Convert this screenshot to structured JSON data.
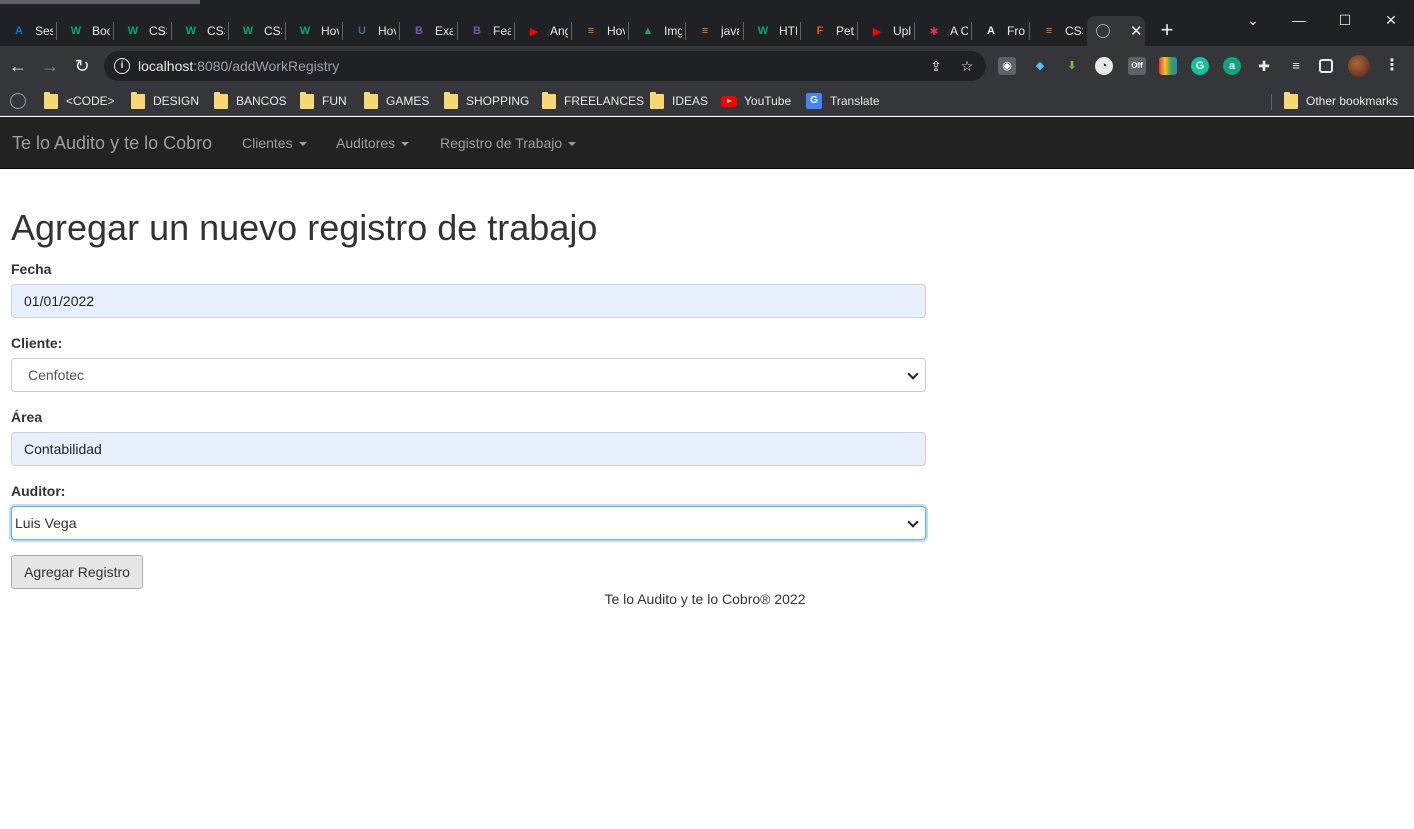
{
  "browser": {
    "tabs": [
      {
        "title": "Ses",
        "icon": "azure-icon",
        "color": "#0078d4",
        "glyph": "A"
      },
      {
        "title": "Boo",
        "icon": "w3schools-icon",
        "color": "#04aa6d",
        "glyph": "W"
      },
      {
        "title": "CSS",
        "icon": "w3schools-icon",
        "color": "#04aa6d",
        "glyph": "W"
      },
      {
        "title": "CSS",
        "icon": "w3schools-icon",
        "color": "#04aa6d",
        "glyph": "W"
      },
      {
        "title": "CSS",
        "icon": "w3schools-icon",
        "color": "#04aa6d",
        "glyph": "W"
      },
      {
        "title": "Hov",
        "icon": "w3schools-icon",
        "color": "#04aa6d",
        "glyph": "W"
      },
      {
        "title": "Hov",
        "icon": "site-icon",
        "color": "#3c6e8f",
        "glyph": "U"
      },
      {
        "title": "Exa",
        "icon": "bootstrap-icon",
        "color": "#7952b3",
        "glyph": "B"
      },
      {
        "title": "Fea",
        "icon": "bootstrap-icon",
        "color": "#7952b3",
        "glyph": "B"
      },
      {
        "title": "Ang",
        "icon": "youtube-icon",
        "color": "#ff0000",
        "glyph": "▶"
      },
      {
        "title": "Hov",
        "icon": "stackoverflow-icon",
        "color": "#f48024",
        "glyph": "≡"
      },
      {
        "title": "Img",
        "icon": "google-drive-icon",
        "color": "#1fa463",
        "glyph": "▲"
      },
      {
        "title": "java",
        "icon": "stackoverflow-icon",
        "color": "#f48024",
        "glyph": "≡"
      },
      {
        "title": "HTM",
        "icon": "w3schools-icon",
        "color": "#04aa6d",
        "glyph": "W"
      },
      {
        "title": "Pet",
        "icon": "figma-icon",
        "color": "#f24e1e",
        "glyph": "F"
      },
      {
        "title": "Upl",
        "icon": "youtube-icon",
        "color": "#ff0000",
        "glyph": "▶"
      },
      {
        "title": "A C",
        "icon": "asterisk-icon",
        "color": "#e0344b",
        "glyph": "✱"
      },
      {
        "title": "Fro",
        "icon": "angular-icon",
        "color": "#e8eaed",
        "glyph": "A"
      },
      {
        "title": "CSS",
        "icon": "stackoverflow-icon",
        "color": "#f48024",
        "glyph": "≡"
      }
    ],
    "url_host": "localhost",
    "url_path": ":8080/addWorkRegistry",
    "bookmarks": [
      {
        "label": "<CODE>",
        "type": "folder"
      },
      {
        "label": "DESIGN",
        "type": "folder"
      },
      {
        "label": "BANCOS",
        "type": "folder"
      },
      {
        "label": "FUN",
        "type": "folder"
      },
      {
        "label": "GAMES",
        "type": "folder"
      },
      {
        "label": "SHOPPING",
        "type": "folder"
      },
      {
        "label": "FREELANCES",
        "type": "folder"
      },
      {
        "label": "IDEAS",
        "type": "folder"
      },
      {
        "label": "YouTube",
        "type": "youtube"
      },
      {
        "label": "Translate",
        "type": "translate"
      }
    ],
    "other_bookmarks": "Other bookmarks"
  },
  "app": {
    "brand": "Te lo Audito y te lo Cobro",
    "nav": [
      {
        "label": "Clientes"
      },
      {
        "label": "Auditores"
      },
      {
        "label": "Registro de Trabajo"
      }
    ]
  },
  "form": {
    "title": "Agregar un nuevo registro de trabajo",
    "fecha_label": "Fecha",
    "fecha_value": "01/01/2022",
    "cliente_label": "Cliente:",
    "cliente_value": "Cenfotec",
    "area_label": "Área",
    "area_value": "Contabilidad",
    "auditor_label": "Auditor:",
    "auditor_value": "Luis Vega",
    "submit_label": "Agregar Registro"
  },
  "footer": "Te lo Audito y te lo Cobro® 2022"
}
